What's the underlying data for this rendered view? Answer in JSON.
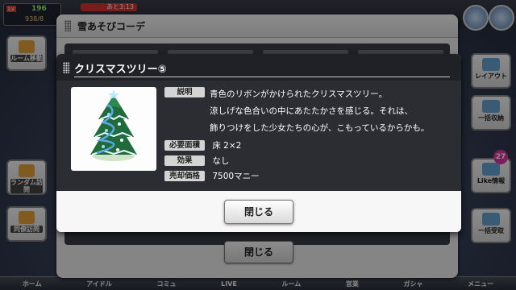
{
  "hud": {
    "level_tag": "Lv",
    "level_value": "196",
    "stamina": "938/8",
    "timer": "あと3:13"
  },
  "left_menu": [
    {
      "label": "ルーム移動"
    },
    {
      "label": "ランダム訪問"
    },
    {
      "label": "同僚訪問"
    }
  ],
  "right_menu": [
    {
      "label": "レイアウト"
    },
    {
      "label": "一括収納"
    },
    {
      "label": "Like情報"
    },
    {
      "label": "一括受取"
    }
  ],
  "like_badge": "27",
  "bottom_nav": [
    "ホーム",
    "アイドル",
    "コミュ",
    "LIVE",
    "ルーム",
    "営業",
    "ガシャ",
    "メニュー"
  ],
  "outer_dialog": {
    "title": "雪あそびコーデ",
    "close_label": "閉じる"
  },
  "item_dialog": {
    "title": "クリスマスツリー⑤",
    "thumbnail_icon": "christmas-tree",
    "description_label": "説明",
    "description_lines": [
      "青色のリボンがかけられたクリスマスツリー。",
      "涼しげな色合いの中にあたたかさを感じる。それは、",
      "飾りつけをした少女たちの心が、こもっているからかも。"
    ],
    "area_label": "必要面積",
    "area_value": "床 2×2",
    "effect_label": "効果",
    "effect_value": "なし",
    "price_label": "売却価格",
    "price_value": "7500マニー",
    "close_label": "閉じる"
  },
  "colors": {
    "dialog_header": "#1f2126",
    "dialog_upper": "#2b2d33",
    "tree_green": "#1f6b3a",
    "ribbon_blue": "#5aa8e8"
  }
}
